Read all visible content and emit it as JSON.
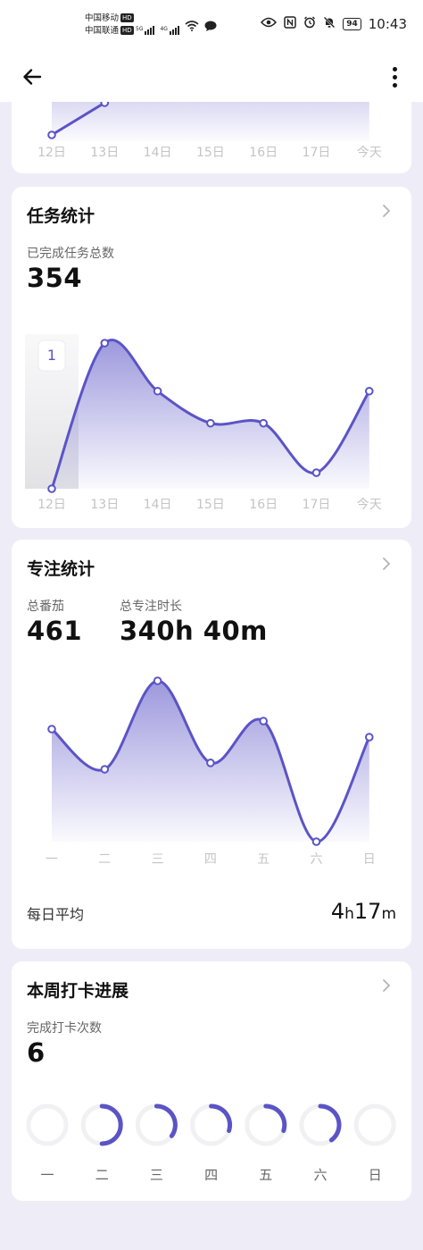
{
  "status_bar": {
    "carrier1": "中国移动",
    "carrier2": "中国联通",
    "hd": "HD",
    "net1": "5G",
    "net2": "4G",
    "battery": "94",
    "time": "10:43"
  },
  "header": {
    "back_icon": "arrow-left-icon",
    "more_icon": "more-vertical-icon"
  },
  "top_card": {
    "chart_data": {
      "type": "area",
      "x": [
        "12日",
        "13日",
        "14日",
        "15日",
        "16日",
        "17日",
        "今天"
      ],
      "values": [
        0,
        1
      ]
    }
  },
  "task_card": {
    "title": "任务统计",
    "stat_label": "已完成任务总数",
    "stat_value": "354",
    "tooltip": "1",
    "chart_data": {
      "type": "area",
      "x": [
        "12日",
        "13日",
        "14日",
        "15日",
        "16日",
        "17日",
        "今天"
      ],
      "values": [
        0,
        1,
        0.67,
        0.45,
        0.45,
        0.11,
        0.67
      ]
    }
  },
  "focus_card": {
    "title": "专注统计",
    "stat1_label": "总番茄",
    "stat1_value": "461",
    "stat2_label": "总专注时长",
    "stat2_value": "340h 40m",
    "avg_label": "每日平均",
    "avg_h": "4",
    "avg_h_unit": "h",
    "avg_m": "17",
    "avg_m_unit": "m",
    "chart_data": {
      "type": "area",
      "x": [
        "一",
        "二",
        "三",
        "四",
        "五",
        "六",
        "日"
      ],
      "values": [
        0.7,
        0.45,
        1.0,
        0.49,
        0.75,
        0,
        0.65
      ]
    }
  },
  "checkin_card": {
    "title": "本周打卡进展",
    "stat_label": "完成打卡次数",
    "stat_value": "6",
    "days": [
      {
        "label": "一",
        "progress": 0
      },
      {
        "label": "二",
        "progress": 0.5
      },
      {
        "label": "三",
        "progress": 0.35
      },
      {
        "label": "四",
        "progress": 0.3
      },
      {
        "label": "五",
        "progress": 0.3
      },
      {
        "label": "六",
        "progress": 0.4
      },
      {
        "label": "日",
        "progress": 0
      }
    ]
  },
  "colors": {
    "accent": "#5b54c6",
    "ring_track": "#f1f1f4",
    "axis_label": "#c4c4c4"
  }
}
